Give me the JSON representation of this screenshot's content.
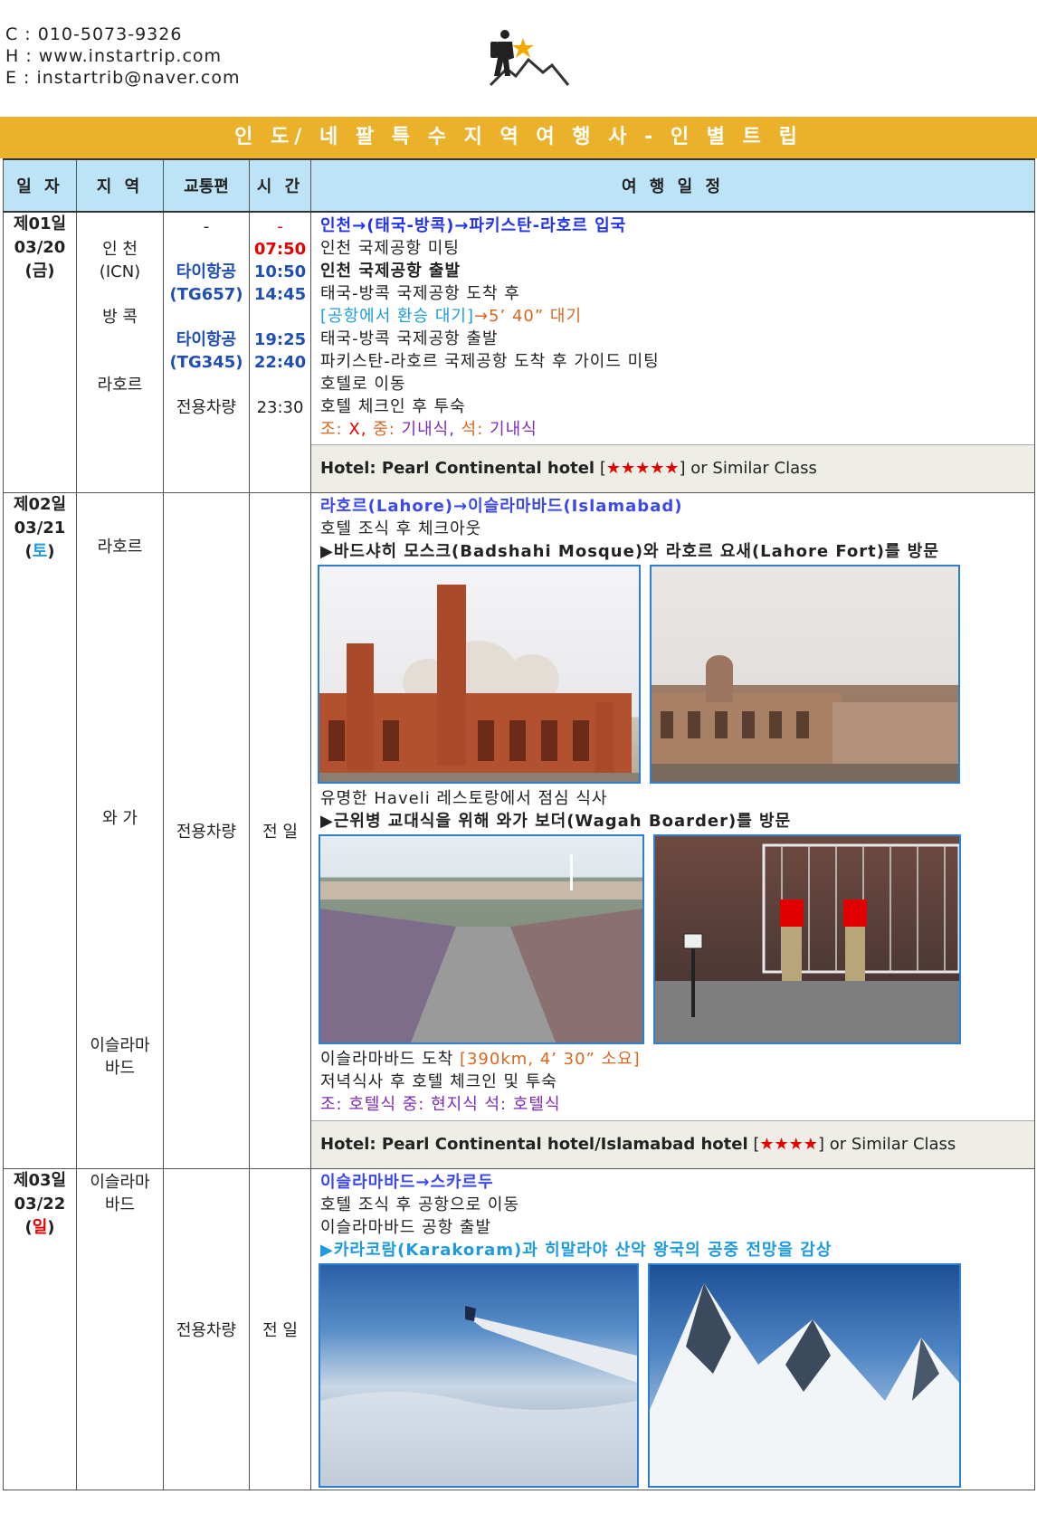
{
  "contact": {
    "phone": "C : 010-5073-9326",
    "home": "H : www.instartrip.com",
    "email": "E : instartrib@naver.com"
  },
  "banner": "인 도/ 네 팔  특 수 지 역 여 행 사 - 인 별 트 립",
  "headers": {
    "date": "일 자",
    "region": "지 역",
    "transport": "교통편",
    "time": "시 간",
    "schedule": "여 행 일 정"
  },
  "colors": {
    "banner": "#EBB12B",
    "header": "#BDE3F7",
    "hotel_bg": "#EEEDE6",
    "photo_border": "#2F7FD0"
  },
  "day1": {
    "day": "제01일",
    "date": "03/20",
    "weekday": "금",
    "region": [
      "",
      "인 천",
      "(ICN)",
      "",
      "방 콕",
      "",
      "",
      "라호르"
    ],
    "transport": [
      "-",
      "",
      "타이항공",
      "(TG657)",
      "",
      "타이항공",
      "(TG345)",
      "",
      "전용차량"
    ],
    "time": [
      "-",
      "07:50",
      "10:50",
      "14:45",
      "",
      "19:25",
      "22:40",
      "",
      "23:30"
    ],
    "title": "인천→(태국-방콕)→파키스탄-라호르 입국",
    "lines": [
      "인천 국제공항 미팅",
      "인천 국제공항 출발",
      "태국-방콕 국제공항 도착 후"
    ],
    "transit_a": "[공항에서 환승 대기]",
    "transit_b": "→5’ 40” 대기",
    "lines2": [
      "태국-방콕 국제공항 출발",
      "파키스탄-라호르 국제공항 도착 후 가이드 미팅",
      "호텔로 이동",
      "호텔 체크인 후 투숙"
    ],
    "meals": {
      "b_label": "조:",
      "b_val": "X,",
      "l_label": "중:",
      "l_val": "기내식,",
      "d_label": "석:",
      "d_val": "기내식"
    },
    "hotel": {
      "name": "Hotel: Pearl Continental hotel",
      "stars": "★★★★★",
      "suffix": "or Similar Class"
    }
  },
  "day2": {
    "day": "제02일",
    "date": "03/21",
    "weekday": "토",
    "region1": "라호르",
    "region2": "와 가",
    "region3a": "이슬라마",
    "region3b": "바드",
    "transport": "전용차량",
    "time": "전 일",
    "title": "라호르(Lahore)→이슬라마바드(Islamabad)",
    "l1": "호텔 조식 후 체크아웃",
    "l2": "▶바드샤히 모스크(Badshahi Mosque)와 라호르 요새(Lahore Fort)를 방문",
    "l3": "유명한 Haveli 레스토랑에서 점심 식사",
    "l4": "▶근위병 교대식을 위해 와가 보더(Wagah Boarder)를 방문",
    "l5a": "이슬라마바드 도착",
    "l5b": "[390km, 4’ 30” 소요]",
    "l6": "저녁식사 후 호텔 체크인 및 투숙",
    "meals": "조: 호텔식 중: 현지식 석: 호텔식",
    "hotel": {
      "name": "Hotel: Pearl Continental hotel/Islamabad hotel",
      "stars": "★★★★",
      "suffix": "or Similar Class"
    }
  },
  "day3": {
    "day": "제03일",
    "date": "03/22",
    "weekday": "일",
    "region_a": "이슬라마",
    "region_b": "바드",
    "transport": "전용차량",
    "time": "전 일",
    "title": "이슬라마바드→스카르두",
    "l1": "호텔 조식 후 공항으로 이동",
    "l2": "이슬라마바드 공항 출발",
    "l3": "▶카라코람(Karakoram)과 히말라야 산악 왕국의 공중 전망을 감상"
  }
}
